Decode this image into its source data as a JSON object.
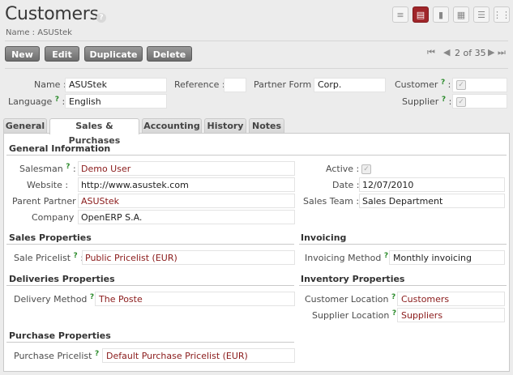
{
  "page": {
    "title": "Customers",
    "help": "?",
    "subtitle": "Name : ASUStek"
  },
  "view_switcher": [
    {
      "icon": "list-view-icon",
      "glyph": "≡"
    },
    {
      "icon": "form-view-icon",
      "glyph": "▤",
      "active": true
    },
    {
      "icon": "graph-view-icon",
      "glyph": "▮"
    },
    {
      "icon": "calendar-view-icon",
      "glyph": "▦"
    },
    {
      "icon": "gantt-view-icon",
      "glyph": "☰"
    },
    {
      "icon": "kanban-view-icon",
      "glyph": "⋮⋮"
    }
  ],
  "toolbar": {
    "new_label": "New",
    "edit_label": "Edit",
    "duplicate_label": "Duplicate",
    "delete_label": "Delete"
  },
  "pager": {
    "text": "2 of 35",
    "first": "⏮",
    "prev": "◀",
    "next": "▶",
    "last": "⏭"
  },
  "header_fields": {
    "name_label": "Name :",
    "name_value": "ASUStek",
    "reference_label": "Reference :",
    "reference_value": "",
    "partner_form_label": "Partner Form :",
    "partner_form_value": "Corp.",
    "customer_label": "Customer",
    "language_label": "Language",
    "language_value": "English",
    "supplier_label": "Supplier",
    "help_mark": "?",
    "colon": ":"
  },
  "tabs": [
    "General",
    "Sales & Purchases",
    "Accounting",
    "History",
    "Notes"
  ],
  "general_info": {
    "heading": "General Information",
    "salesman_label": "Salesman",
    "salesman_value": "Demo User",
    "website_label": "Website :",
    "website_value": "http://www.asustek.com",
    "parent_partner_label": "Parent Partner :",
    "parent_partner_value": "ASUStek",
    "company_label": "Company :",
    "company_value": "OpenERP S.A.",
    "active_label": "Active :",
    "date_label": "Date :",
    "date_value": "12/07/2010",
    "sales_team_label": "Sales Team :",
    "sales_team_value": "Sales Department"
  },
  "sales_properties": {
    "heading": "Sales Properties",
    "pricelist_label": "Sale Pricelist",
    "pricelist_value": "Public Pricelist (EUR)"
  },
  "invoicing": {
    "heading": "Invoicing",
    "method_label": "Invoicing Method",
    "method_value": "Monthly invoicing"
  },
  "deliveries": {
    "heading": "Deliveries Properties",
    "method_label": "Delivery Method",
    "method_value": "The Poste"
  },
  "inventory": {
    "heading": "Inventory Properties",
    "customer_loc_label": "Customer Location",
    "customer_loc_value": "Customers",
    "supplier_loc_label": "Supplier Location",
    "supplier_loc_value": "Suppliers"
  },
  "purchase": {
    "heading": "Purchase Properties",
    "pricelist_label": "Purchase Pricelist",
    "pricelist_value": "Default Purchase Pricelist (EUR)"
  }
}
